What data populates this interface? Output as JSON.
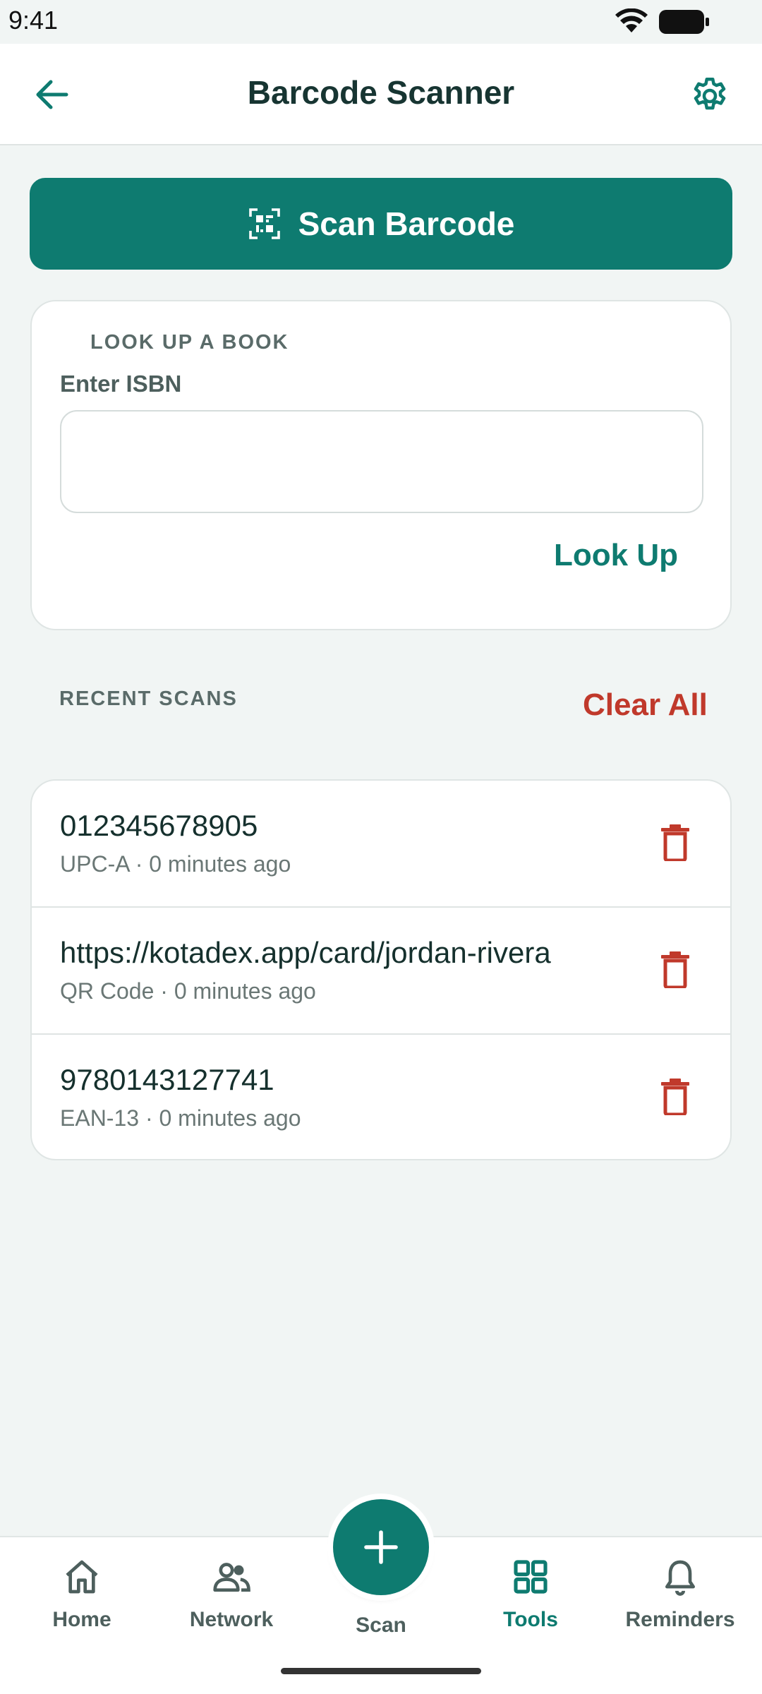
{
  "status_bar": {
    "time": "9:41",
    "icons": [
      "wifi-icon",
      "battery-icon"
    ]
  },
  "app_bar": {
    "title": "Barcode Scanner",
    "left_icon": "arrow-left-icon",
    "right_icon": "gear-icon"
  },
  "scan_button": {
    "label": "Scan Barcode",
    "icon": "qr-code-scan-icon"
  },
  "lookup": {
    "heading": "LOOK UP A BOOK",
    "field_label": "Enter ISBN",
    "value": "",
    "placeholder": "",
    "button_label": "Look Up"
  },
  "recent": {
    "heading": "RECENT SCANS",
    "clear_label": "Clear All",
    "items": [
      {
        "value": "012345678905",
        "meta": "UPC-A · 0 minutes ago"
      },
      {
        "value": "https://kotadex.app/card/jordan-rivera",
        "meta": "QR Code · 0 minutes ago"
      },
      {
        "value": "9780143127741",
        "meta": "EAN-13 · 0 minutes ago"
      }
    ]
  },
  "bottom_nav": {
    "items": [
      {
        "label": "Home",
        "icon": "home-icon"
      },
      {
        "label": "Network",
        "icon": "people-icon"
      },
      {
        "label": "Scan",
        "icon": "plus-icon"
      },
      {
        "label": "Tools",
        "icon": "grid-icon",
        "active": true
      },
      {
        "label": "Reminders",
        "icon": "bell-icon"
      }
    ]
  },
  "colors": {
    "accent": "#0e7b70",
    "danger": "#c0392b",
    "background": "#f1f5f4",
    "surface": "#ffffff"
  }
}
